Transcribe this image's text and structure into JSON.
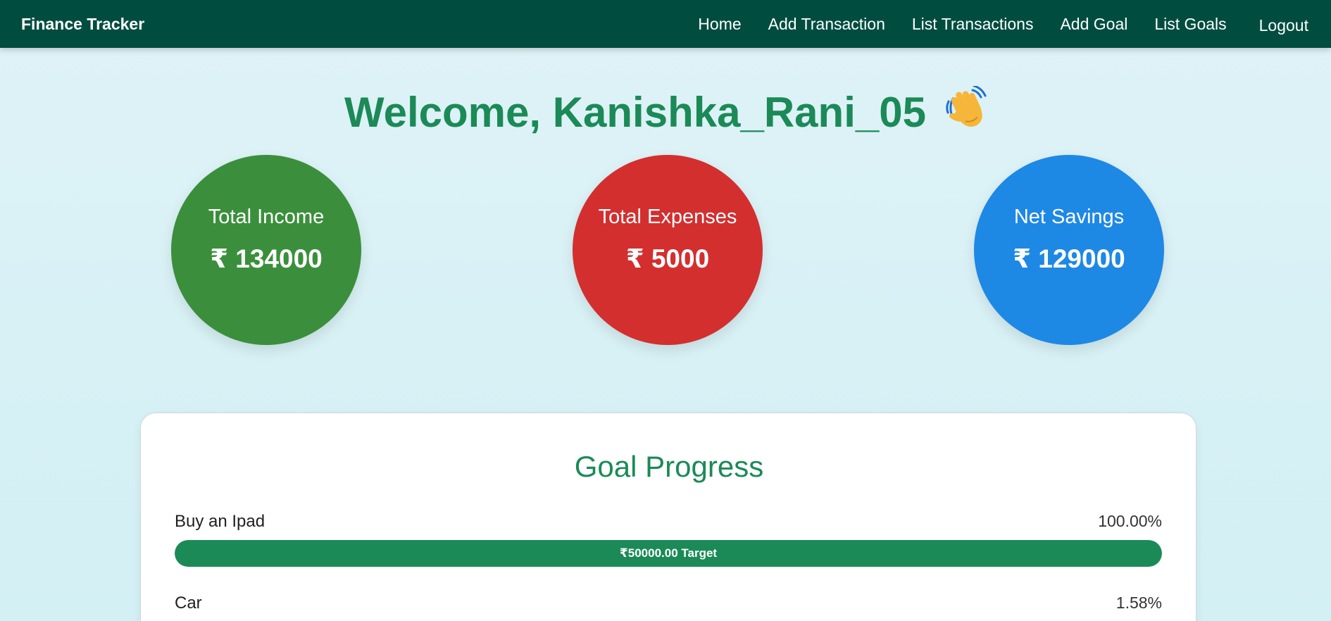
{
  "navbar": {
    "brand": "Finance Tracker",
    "links": [
      "Home",
      "Add Transaction",
      "List Transactions",
      "Add Goal",
      "List Goals"
    ],
    "logout": "Logout",
    "background_color": "#004d40"
  },
  "welcome": {
    "text": "Welcome, Kanishka_Rani_05",
    "icon": "waving-hand-icon",
    "color": "#1b8a57"
  },
  "stats": {
    "income": {
      "label": "Total Income",
      "value": "₹ 134000",
      "color": "#3b8f3c"
    },
    "expenses": {
      "label": "Total Expenses",
      "value": "₹ 5000",
      "color": "#d32f2f"
    },
    "savings": {
      "label": "Net Savings",
      "value": "₹ 129000",
      "color": "#1e88e5"
    }
  },
  "goals": {
    "title": "Goal Progress",
    "items": [
      {
        "name": "Buy an Ipad",
        "percent_label": "100.00%",
        "progress": 100.0,
        "bar_text": "₹50000.00 Target",
        "color": "#1b8a57"
      },
      {
        "name": "Car",
        "percent_label": "1.58%",
        "progress": 1.58,
        "bar_text": "",
        "color": "#d32f2f"
      }
    ]
  }
}
